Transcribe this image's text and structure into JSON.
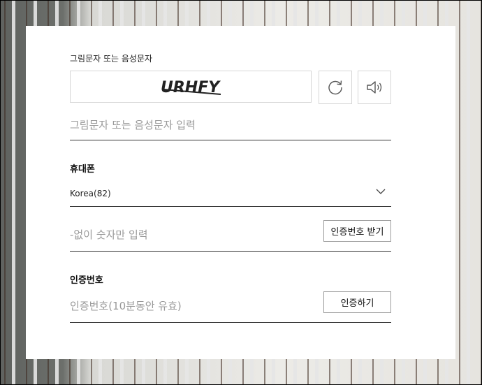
{
  "captcha": {
    "label": "그림문자 또는 음성문자",
    "image_text": "URHFY",
    "refresh_icon": "refresh-icon",
    "audio_icon": "speaker-icon",
    "input_placeholder": "그림문자 또는 음성문자 입력"
  },
  "phone": {
    "title": "휴대폰",
    "country_selected": "Korea(82)",
    "number_placeholder": "-없이 숫자만 입력",
    "request_code_button": "인증번호 받기"
  },
  "verification": {
    "title": "인증번호",
    "code_placeholder": "인증번호(10분동안 유효)",
    "verify_button": "인증하기"
  }
}
